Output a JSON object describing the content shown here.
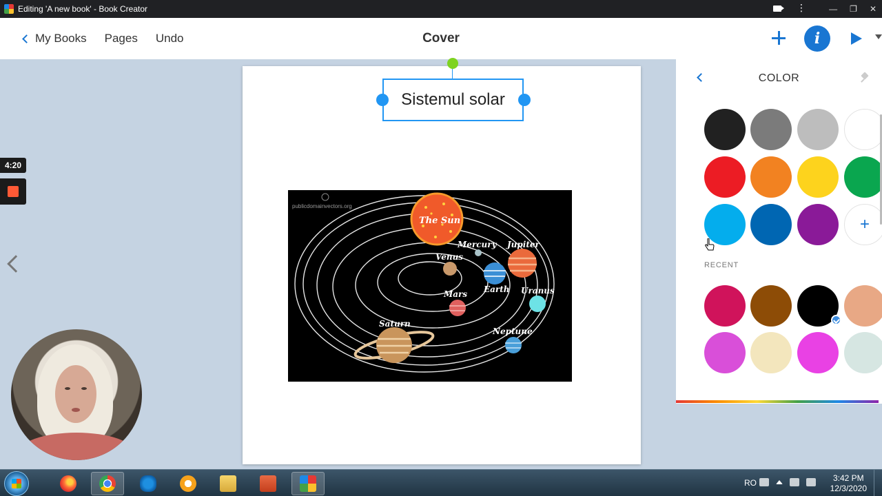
{
  "window": {
    "title": "Editing 'A new book' - Book Creator",
    "controls": {
      "minimize": "—",
      "restore": "❐",
      "close": "✕"
    }
  },
  "toolbar": {
    "back_label": "My Books",
    "pages_label": "Pages",
    "undo_label": "Undo",
    "page_title": "Cover",
    "info_label": "i"
  },
  "book_page": {
    "title_text": "Sistemul solar",
    "image": {
      "watermark": "publicdomainvectors.org",
      "sun_label": "The Sun",
      "planets": [
        "Mercury",
        "Venus",
        "Earth",
        "Mars",
        "Jupiter",
        "Saturn",
        "Uranus",
        "Neptune"
      ]
    }
  },
  "recording": {
    "timer": "4:20"
  },
  "color_panel": {
    "title": "COLOR",
    "recent_label": "RECENT",
    "add_label": "+",
    "palette": [
      "#212121",
      "#7b7b7b",
      "#bdbdbd",
      "#ffffff",
      "#ec1c24",
      "#f28221",
      "#fdd31d",
      "#0aa64f",
      "#04aded",
      "#0066b2",
      "#8a1a98"
    ],
    "recent": [
      "#d0135b",
      "#8d4c06",
      "#000000",
      "#e8a885",
      "#d94fd9",
      "#f3e6bd",
      "#e941e4",
      "#d6e6e2"
    ],
    "selected_recent_index": 2
  },
  "taskbar": {
    "language": "RO",
    "time": "3:42 PM",
    "date": "12/3/2020"
  },
  "colors": {
    "accent": "#1976d2",
    "selection": "#2196f3",
    "rotate_handle": "#7ed321"
  }
}
